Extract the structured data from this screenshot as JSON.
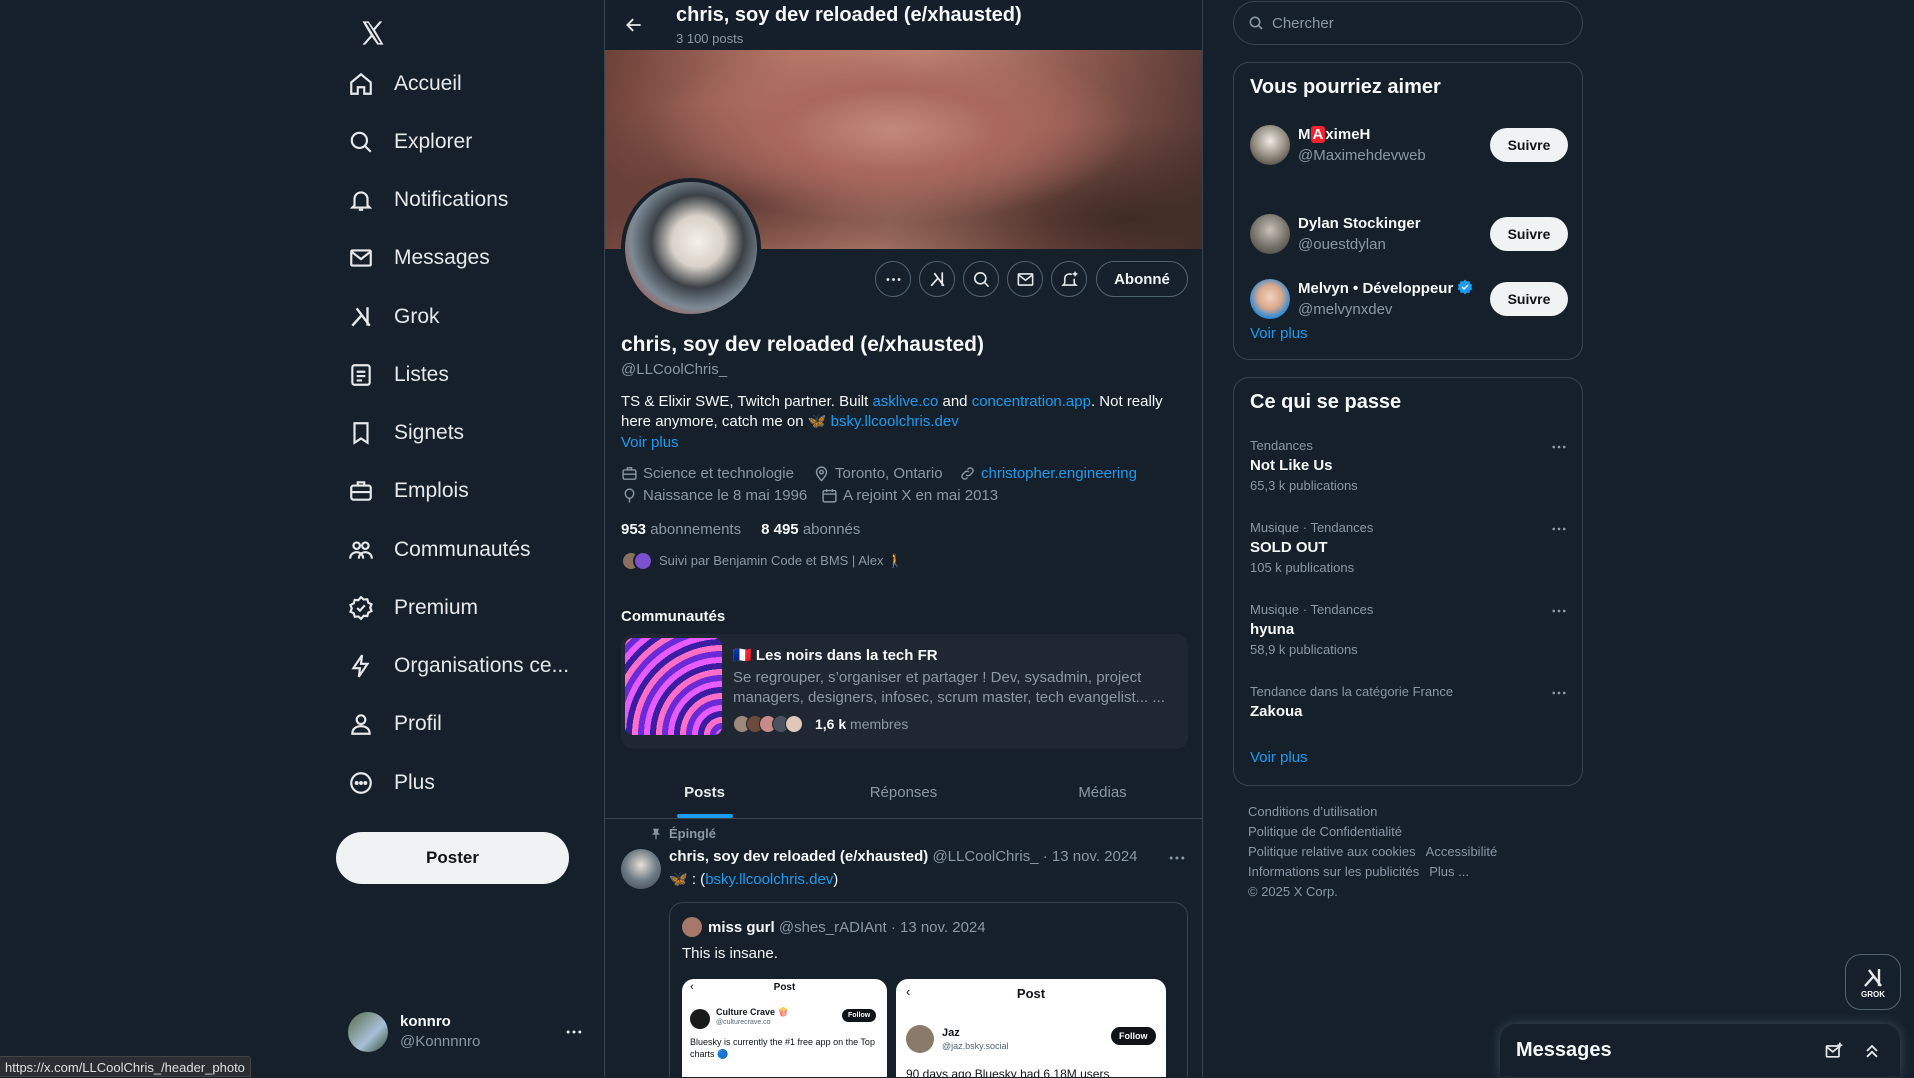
{
  "nav": {
    "items": [
      {
        "label": "Accueil"
      },
      {
        "label": "Explorer"
      },
      {
        "label": "Notifications"
      },
      {
        "label": "Messages"
      },
      {
        "label": "Grok"
      },
      {
        "label": "Listes"
      },
      {
        "label": "Signets"
      },
      {
        "label": "Emplois"
      },
      {
        "label": "Communautés"
      },
      {
        "label": "Premium"
      },
      {
        "label": "Organisations ce..."
      },
      {
        "label": "Profil"
      },
      {
        "label": "Plus"
      }
    ],
    "post_label": "Poster",
    "account": {
      "name": "konnro",
      "handle": "@Konnnnro"
    }
  },
  "header": {
    "title": "chris, soy dev reloaded (e/xhausted)",
    "posts_count": "3 100 posts"
  },
  "profile": {
    "follow_state": "Abonné",
    "name": "chris, soy dev reloaded (e/xhausted)",
    "handle": "@LLCoolChris_",
    "bio": {
      "part1": "TS & Elixir SWE, Twitch partner. Built ",
      "link1": "asklive.co",
      "part2": " and ",
      "link2": "concentration.app",
      "part3": ". Not really here anymore, catch me on ",
      "emoji": "🦋",
      "link3": "bsky.llcoolchris.dev"
    },
    "see_more": "Voir plus",
    "category": "Science et technologie",
    "location": "Toronto, Ontario",
    "website": "christopher.engineering",
    "birthday": "Naissance le 8 mai 1996",
    "joined": "A rejoint X en mai 2013",
    "following_count": "953",
    "following_label": "abonnements",
    "followers_count": "8 495",
    "followers_label": "abonnés",
    "followed_by": "Suivi par Benjamin Code et BMS | Alex 🚶"
  },
  "communities": {
    "title": "Communautés",
    "card": {
      "flag": "🇫🇷",
      "name": "Les noirs dans la tech FR",
      "description": "Se regrouper, s’organiser et partager ! Dev, sysadmin, project managers, designers, infosec, scrum master, tech evangelist... ...",
      "members_count": "1,6 k",
      "members_label": "membres"
    }
  },
  "tabs": [
    {
      "label": "Posts"
    },
    {
      "label": "Réponses"
    },
    {
      "label": "Médias"
    }
  ],
  "pinned_tweet": {
    "pinned_label": "Épinglé",
    "author": "chris, soy dev reloaded (e/xhausted)",
    "handle": "@LLCoolChris_",
    "date": "13 nov. 2024",
    "text_prefix": "🦋 : (",
    "link": "bsky.llcoolchris.dev",
    "text_suffix": ")",
    "quote": {
      "author": "miss gurl",
      "handle": "@shes_rADIAnt",
      "date": "13 nov. 2024",
      "text": "This is insane.",
      "shot1": {
        "title": "Post",
        "user": "Culture Crave 🍿",
        "handle": "@culturecrave.co",
        "follow": "Follow",
        "text": "Bluesky is currently the #1 free app on the Top charts 🔵"
      },
      "shot2": {
        "title": "Post",
        "user": "Jaz",
        "handle": "@jaz.bsky.social",
        "follow": "Follow",
        "text": "90 days ago Bluesky had 6.18M users"
      }
    }
  },
  "search": {
    "placeholder": "Chercher"
  },
  "suggestions": {
    "title": "Vous pourriez aimer",
    "users": [
      {
        "name_a": "M",
        "name_badge": "A",
        "name_b": "ximeH",
        "handle": "@Maximehdevweb",
        "button": "Suivre"
      },
      {
        "name": "Dylan Stockinger",
        "handle": "@ouestdylan",
        "button": "Suivre"
      },
      {
        "name": "Melvyn • Développeur",
        "handle": "@melvynxdev",
        "button": "Suivre"
      }
    ],
    "see_more": "Voir plus"
  },
  "trends": {
    "title": "Ce qui se passe",
    "items": [
      {
        "category": "Tendances",
        "title": "Not Like Us",
        "count": "65,3 k publications"
      },
      {
        "category": "Musique · Tendances",
        "title": "SOLD OUT",
        "count": "105 k publications"
      },
      {
        "category": "Musique · Tendances",
        "title": "hyuna",
        "count": "58,9 k publications"
      },
      {
        "category": "Tendance dans la catégorie France",
        "title": "Zakoua",
        "count": ""
      }
    ],
    "see_more": "Voir plus"
  },
  "footer": {
    "links": [
      "Conditions d’utilisation",
      "Politique de Confidentialité",
      "Politique relative aux cookies",
      "Accessibilité",
      "Informations sur les publicités",
      "Plus ..."
    ],
    "copyright": "© 2025 X Corp."
  },
  "grok_fab": {
    "label": "GROK"
  },
  "messages_drawer": {
    "title": "Messages"
  },
  "status_bar": {
    "url": "https://x.com/LLCoolChris_/header_photo"
  },
  "colors": {
    "background": "#15202b",
    "accent": "#1d9bf0",
    "border": "#38444d",
    "muted": "#8b98a5"
  }
}
